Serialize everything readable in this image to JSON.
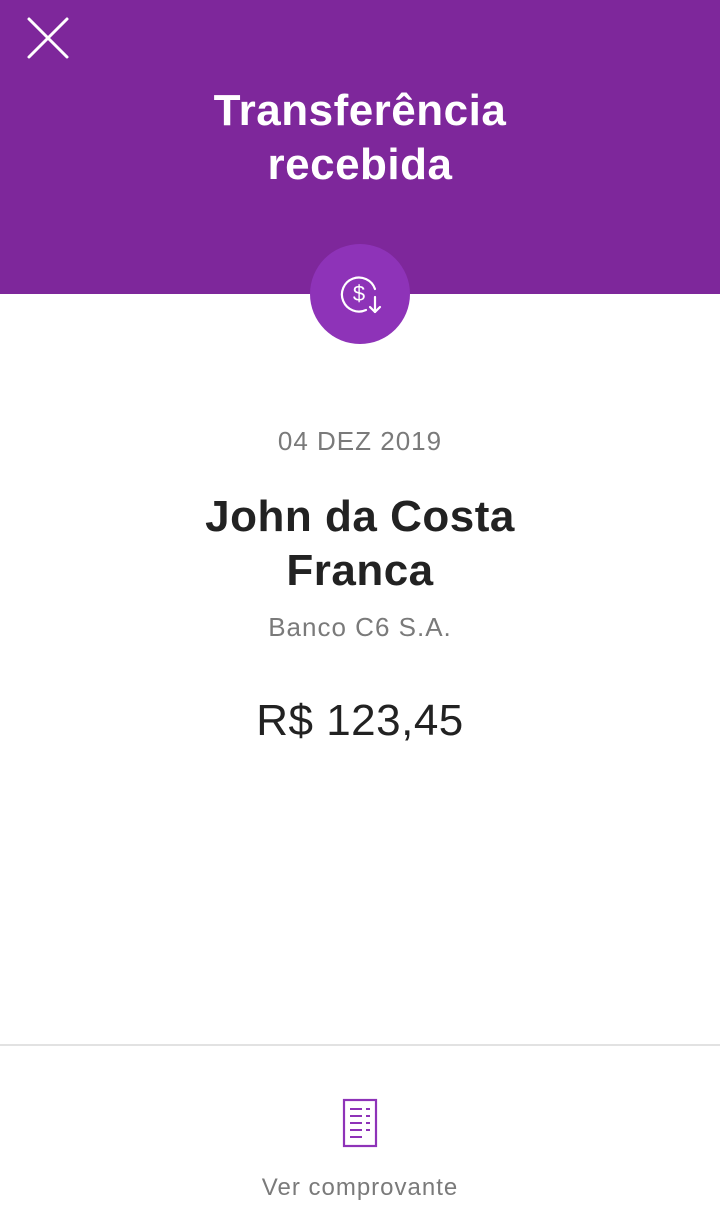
{
  "header": {
    "title_line1": "Transferência",
    "title_line2": "recebida",
    "close_icon": "close-icon",
    "badge_icon": "money-receive-icon",
    "background_color": "#7e279b"
  },
  "details": {
    "date": "04 DEZ 2019",
    "sender_line1": "John da Costa",
    "sender_line2": "Franca",
    "bank": "Banco C6 S.A.",
    "amount": "R$ 123,45"
  },
  "footer": {
    "receipt_icon": "receipt-icon",
    "receipt_label": "Ver comprovante"
  },
  "colors": {
    "accent": "#8e33b8",
    "text_primary": "#222222",
    "text_secondary": "#7a7a7a"
  }
}
